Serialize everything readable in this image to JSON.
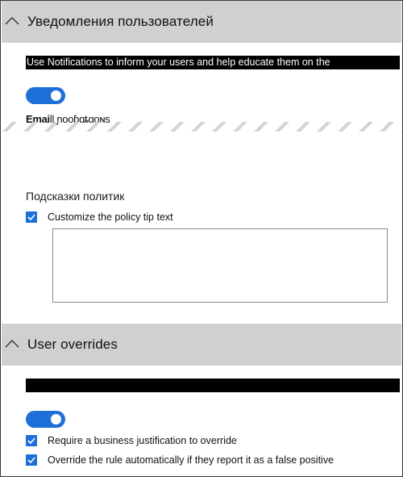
{
  "notifications_section": {
    "title": "Уведомления пользователей",
    "description": "Use Notifications to inform your users and help educate them on the",
    "toggle_on": true,
    "email_label_bold": "Emai",
    "email_label_rest": "ll ɲooɓɑȶɑoɴs"
  },
  "policy_tips": {
    "heading": "Подсказки политик",
    "customize_label": "Customize the policy tip text",
    "customize_checked": true,
    "textarea_value": ""
  },
  "overrides_section": {
    "title": "User overrides",
    "description": "",
    "toggle_on": true,
    "options": [
      {
        "label": "Require a business justification to override",
        "checked": true
      },
      {
        "label": "Override the rule automatically if they report it as a false positive",
        "checked": true
      }
    ]
  },
  "colors": {
    "accent": "#1f6fd8",
    "header_bg": "#d0d0d0"
  }
}
